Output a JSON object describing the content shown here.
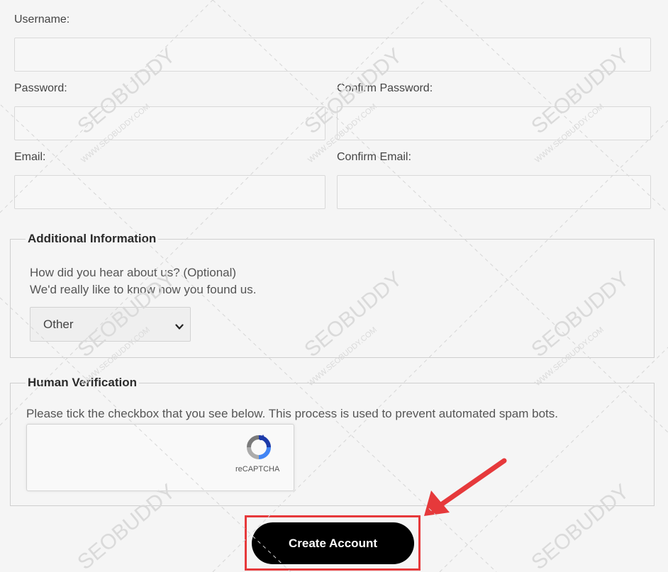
{
  "form": {
    "username_label": "Username:",
    "password_label": "Password:",
    "confirm_password_label": "Confirm Password:",
    "email_label": "Email:",
    "confirm_email_label": "Confirm Email:"
  },
  "additional": {
    "legend": "Additional Information",
    "question": "How did you hear about us? (Optional)",
    "subtext": "We'd really like to know how you found us.",
    "selected_option": "Other"
  },
  "verification": {
    "legend": "Human Verification",
    "instruction": "Please tick the checkbox that you see below. This process is used to prevent automated spam bots.",
    "captcha_label": "reCAPTCHA"
  },
  "actions": {
    "create_account_label": "Create Account"
  },
  "colors": {
    "highlight": "#e6393b",
    "button_bg": "#000000"
  },
  "watermark": {
    "brand": "SEOBUDDY",
    "url": "WWW.SEOBUDDY.COM"
  }
}
